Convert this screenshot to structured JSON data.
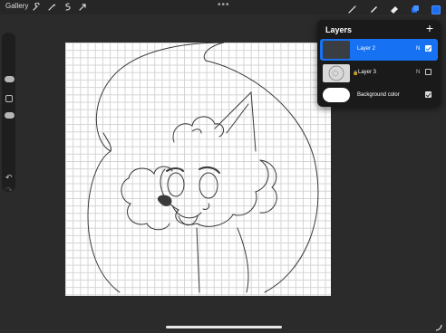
{
  "topbar": {
    "gallery_label": "Gallery",
    "more_label": "•••",
    "left_tools": [
      "wrench-icon",
      "magic-wand-icon",
      "selection-icon",
      "transform-arrow-icon"
    ],
    "right_tools": [
      "brush-icon",
      "smudge-icon",
      "eraser-icon",
      "layers-icon",
      "color-swatch"
    ],
    "active_color": "#1d6ff2"
  },
  "sidebar": {
    "undo_label": "↶",
    "redo_label": "↷"
  },
  "layers_panel": {
    "title": "Layers",
    "add_label": "+",
    "layers": [
      {
        "name": "Layer 2",
        "blend": "N",
        "visible": true,
        "selected": true
      },
      {
        "name": "Layer 3",
        "blend": "N",
        "visible": false,
        "selected": false
      }
    ],
    "background": {
      "name": "Background color",
      "visible": true,
      "color": "#ffffff"
    }
  }
}
